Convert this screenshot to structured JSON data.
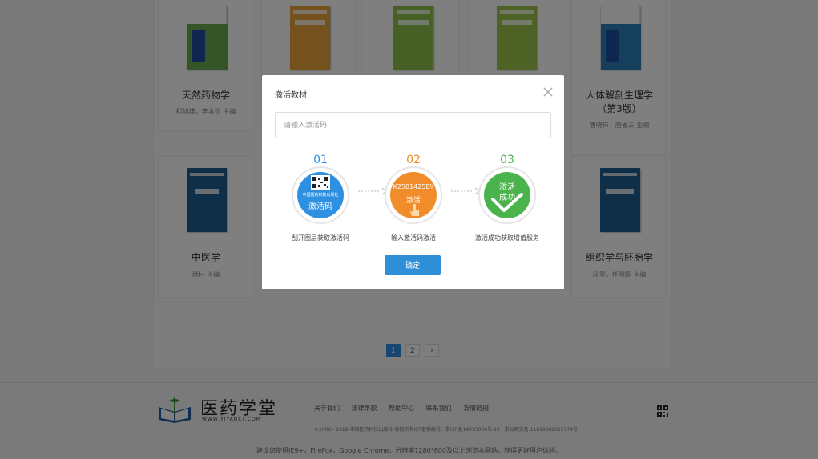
{
  "books": [
    {
      "title": "天然药物学",
      "author": "祖旭雄，李本银 主编",
      "color": "#6aa84f"
    },
    {
      "title": "",
      "author": "",
      "color": "#e8a33a"
    },
    {
      "title": "",
      "author": "",
      "color": "#8fc14a"
    },
    {
      "title": "",
      "author": "",
      "color": "#9cc54a"
    },
    {
      "title": "人体解剖生理学（第3版）",
      "author": "唐晓伟，唐省三 主编",
      "color": "#2a7fb4"
    },
    {
      "title": "中医学",
      "author": "杨柱 主编",
      "color": "#1c5f8e"
    },
    {
      "title": "组织学与胚胎学",
      "author": "段雯，任明姬 主编",
      "color": "#1c5f8e"
    }
  ],
  "pagination": {
    "pages": [
      "1",
      "2"
    ],
    "next": "›"
  },
  "modal": {
    "title": "激活教材",
    "input_placeholder": "请输入激活码",
    "steps": [
      {
        "num": "01",
        "disc_top": "中国医药科技出版社",
        "disc_main": "激活码",
        "label": "刮开图层获取激活码",
        "color": "#2f8fe0"
      },
      {
        "num": "02",
        "disc_top": "K2501425BY",
        "disc_main": "激活",
        "label": "输入激活码激活",
        "color": "#f08c2a"
      },
      {
        "num": "03",
        "disc_top": "激活",
        "disc_main": "成功",
        "label": "激活成功获取增值服务",
        "color": "#4bb34b"
      }
    ],
    "confirm_label": "确定"
  },
  "footer": {
    "logo_text": "医药学堂",
    "logo_sub": "WWW.YIYAOXT.COM",
    "links": [
      "关于我们",
      "法律条款",
      "帮助中心",
      "联系我们",
      "友情链接"
    ],
    "copyright": "©2006 - 2018 中国医药科技出版社 版权所有ICP备案编号：京ICP备14035006号-10 | 京公网安备 11010802025774号",
    "bottom_notice": "建议您使用IE9+，FireFox，Google Chrome，分辨率1280*800及以上浏览本网站，获得更好用户体验。"
  },
  "colors": {
    "accent": "#2e8fd8",
    "orange": "#f08c2a",
    "green": "#4bb34b"
  }
}
